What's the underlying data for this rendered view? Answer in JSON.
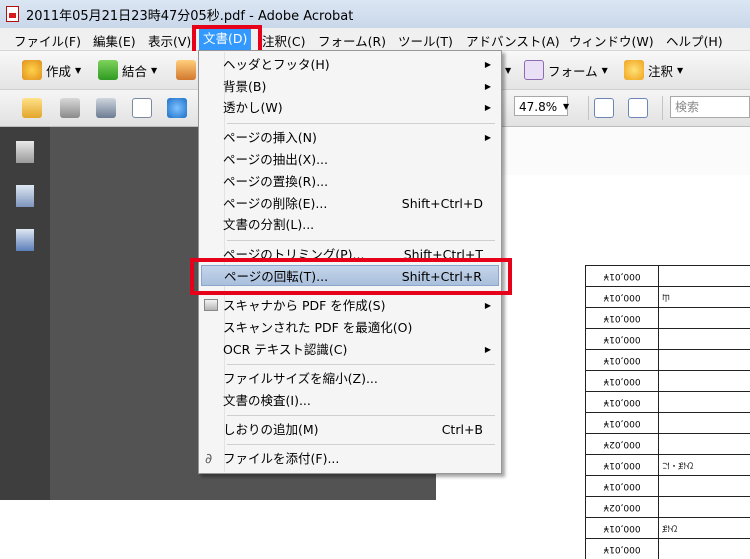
{
  "window": {
    "title": "2011年05月21日23時47分05秒.pdf - Adobe Acrobat"
  },
  "menubar": [
    {
      "label": "ファイル(F)"
    },
    {
      "label": "編集(E)"
    },
    {
      "label": "表示(V)"
    },
    {
      "label": "文書(D)",
      "active": true
    },
    {
      "label": "注釈(C)"
    },
    {
      "label": "フォーム(R)"
    },
    {
      "label": "ツール(T)"
    },
    {
      "label": "アドバンスト(A)"
    },
    {
      "label": "ウィンドウ(W)"
    },
    {
      "label": "ヘルプ(H)"
    }
  ],
  "toolbar": {
    "create_label": "作成",
    "combine_label": "結合",
    "form_label": "フォーム",
    "comment_label": "注釈",
    "zoom_value": "47.8%",
    "search_placeholder": "検索"
  },
  "menu": {
    "items": [
      {
        "label": "ヘッダとフッタ(H)",
        "submenu": true
      },
      {
        "label": "背景(B)",
        "submenu": true
      },
      {
        "label": "透かし(W)",
        "submenu": true
      },
      {
        "label": "ページの挿入(N)",
        "submenu": true
      },
      {
        "label": "ページの抽出(X)..."
      },
      {
        "label": "ページの置換(R)..."
      },
      {
        "label": "ページの削除(E)...",
        "shortcut": "Shift+Ctrl+D"
      },
      {
        "label": "文書の分割(L)..."
      },
      {
        "label": "ページのトリミング(P)...",
        "shortcut": "Shift+Ctrl+T"
      },
      {
        "label": "ページの回転(T)...",
        "shortcut": "Shift+Ctrl+R",
        "highlighted": true
      },
      {
        "label": "スキャナから PDF を作成(S)",
        "submenu": true
      },
      {
        "label": "スキャンされた PDF を最適化(O)"
      },
      {
        "label": "OCR テキスト認識(C)",
        "submenu": true
      },
      {
        "label": "ファイルサイズを縮小(Z)..."
      },
      {
        "label": "文書の検査(I)..."
      },
      {
        "label": "しおりの追加(M)",
        "shortcut": "Ctrl+B"
      },
      {
        "label": "ファイルを添付(F)..."
      }
    ]
  },
  "document": {
    "rows": [
      {
        "amount": "000,01¥",
        "note": ""
      },
      {
        "amount": "000,01¥",
        "note": "山"
      },
      {
        "amount": "000,01¥",
        "note": ""
      },
      {
        "amount": "000,01¥",
        "note": ""
      },
      {
        "amount": "000,01¥",
        "note": ""
      },
      {
        "amount": "000,01¥",
        "note": ""
      },
      {
        "amount": "000,01¥",
        "note": ""
      },
      {
        "amount": "000,01¥",
        "note": ""
      },
      {
        "amount": "000,02¥",
        "note": ""
      },
      {
        "amount": "000,01¥",
        "note": "ひぼ・に"
      },
      {
        "amount": "000,01¥",
        "note": ""
      },
      {
        "amount": "000,02¥",
        "note": ""
      },
      {
        "amount": "000,01¥",
        "note": "ひぼ"
      },
      {
        "amount": "000,01¥",
        "note": ""
      }
    ]
  },
  "colors": {
    "highlight_box": "#e6001a",
    "menu_active": "#3399ff"
  }
}
